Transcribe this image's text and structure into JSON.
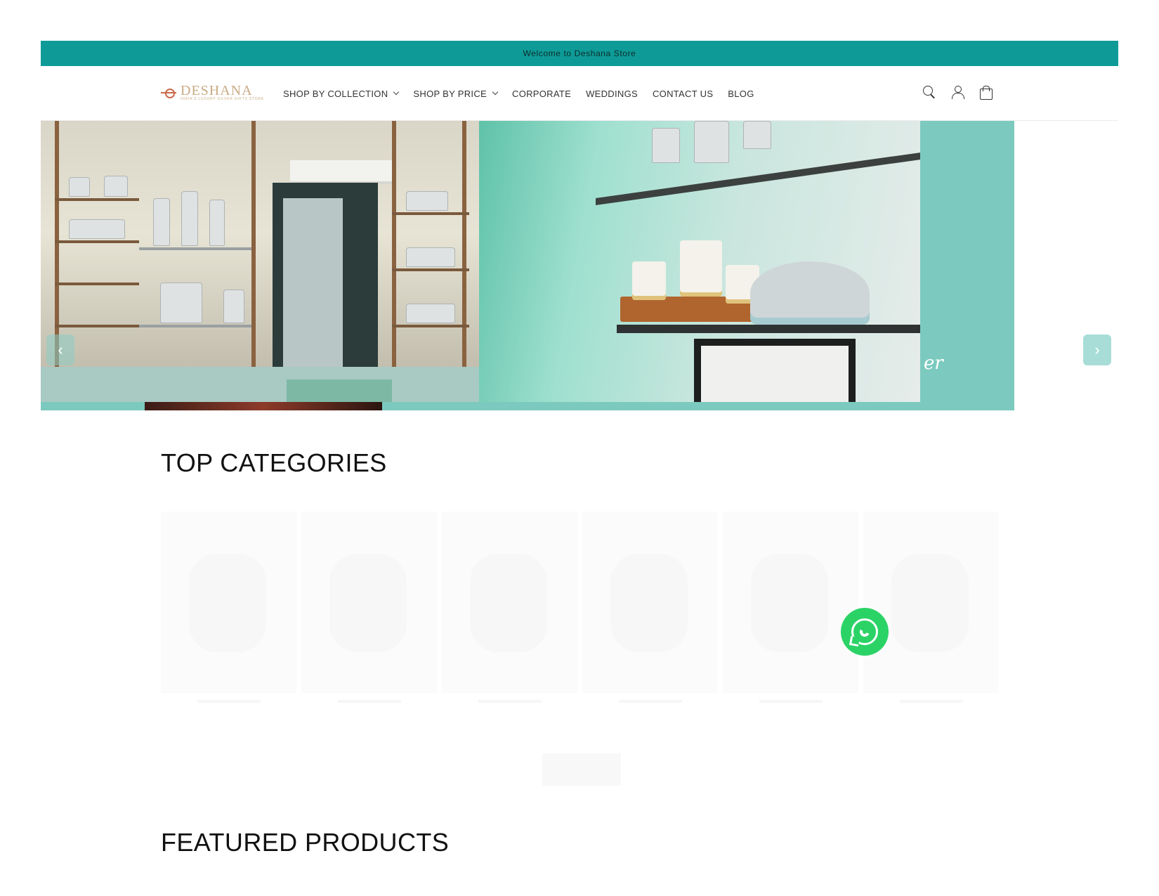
{
  "announcement": {
    "text": "Welcome to Deshana Store"
  },
  "brand": {
    "name": "DESHANA",
    "tagline": "INDIA'S LUXURY SILVER GIFTS STORE"
  },
  "nav": {
    "items": [
      {
        "label": "SHOP BY COLLECTION",
        "has_dropdown": true
      },
      {
        "label": "SHOP BY PRICE",
        "has_dropdown": true
      },
      {
        "label": "CORPORATE",
        "has_dropdown": false
      },
      {
        "label": "WEDDINGS",
        "has_dropdown": false
      },
      {
        "label": "CONTACT US",
        "has_dropdown": false
      },
      {
        "label": "BLOG",
        "has_dropdown": false
      }
    ]
  },
  "header_icons": [
    "search-icon",
    "account-icon",
    "cart-icon"
  ],
  "hero": {
    "prev_label": "‹",
    "next_label": "›",
    "script_text": "er"
  },
  "sections": {
    "top_categories": "TOP CATEGORIES",
    "featured_products": "FEATURED PRODUCTS"
  },
  "colors": {
    "announcement_bg": "#0e9b97",
    "hero_teal": "#7ccabf",
    "whatsapp_green": "#2bd366",
    "brand_gold": "#c8ab83"
  }
}
